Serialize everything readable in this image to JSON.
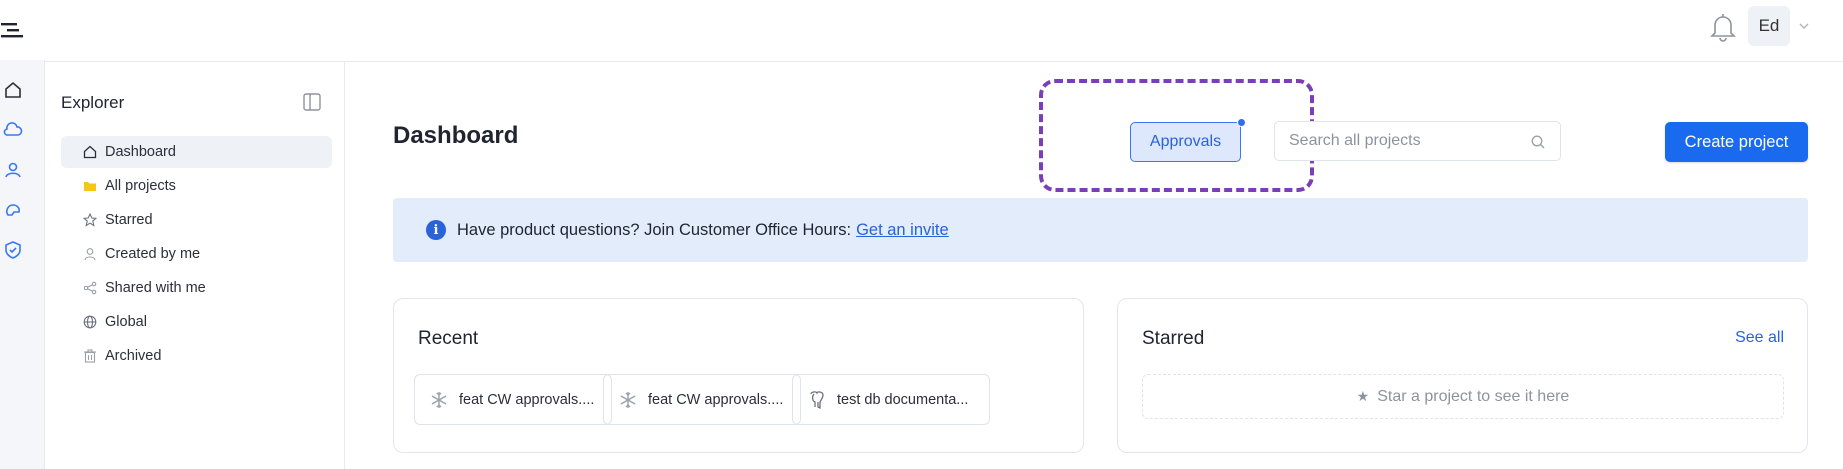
{
  "topbar": {
    "avatar_initials": "Ed"
  },
  "rail": {
    "icons": [
      "menu-icon",
      "home-icon",
      "cloud-icon",
      "user-icon",
      "plugin-icon",
      "shield-icon"
    ]
  },
  "explorer": {
    "title": "Explorer",
    "items": [
      {
        "label": "Dashboard",
        "icon": "home-icon",
        "active": true
      },
      {
        "label": "All projects",
        "icon": "folder-icon"
      },
      {
        "label": "Starred",
        "icon": "star-icon"
      },
      {
        "label": "Created by me",
        "icon": "user-icon"
      },
      {
        "label": "Shared with me",
        "icon": "share-icon"
      },
      {
        "label": "Global",
        "icon": "globe-icon"
      },
      {
        "label": "Archived",
        "icon": "trash-icon"
      }
    ]
  },
  "main": {
    "title": "Dashboard",
    "approvals_label": "Approvals",
    "search_placeholder": "Search all projects",
    "create_label": "Create project",
    "banner": {
      "text": "Have product questions? Join Customer Office Hours:",
      "link": "Get an invite"
    },
    "recent": {
      "title": "Recent",
      "projects": [
        {
          "name": "feat CW approvals....",
          "icon": "snowflake-icon"
        },
        {
          "name": "feat CW approvals....",
          "icon": "snowflake-icon"
        },
        {
          "name": "test db documenta...",
          "icon": "postgres-icon"
        }
      ]
    },
    "starred": {
      "title": "Starred",
      "see_all": "See all",
      "empty": "Star a project to see it here"
    }
  },
  "colors": {
    "accent": "#1a6af0",
    "highlight": "#7a3fb8",
    "banner_bg": "#e3ecfb"
  }
}
